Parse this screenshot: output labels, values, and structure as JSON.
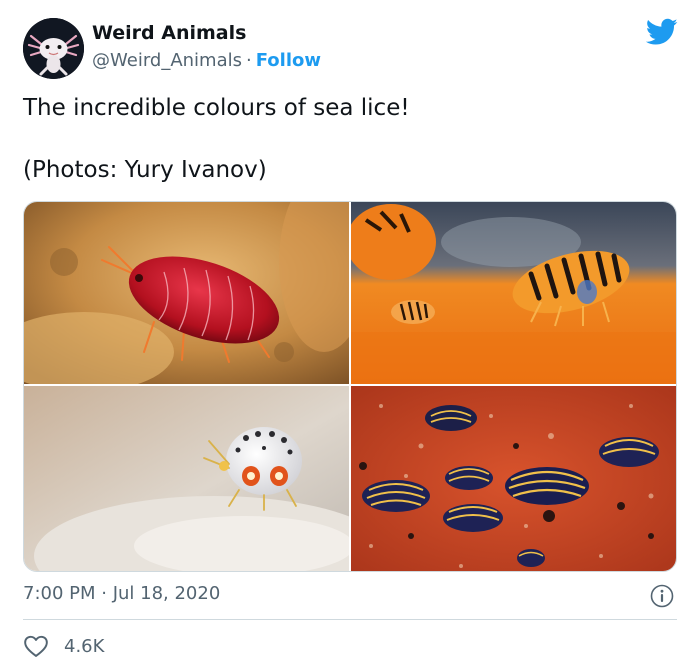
{
  "author": {
    "name": "Weird Animals",
    "handle": "@Weird_Animals",
    "separator": "·",
    "follow_label": "Follow",
    "avatar_icon": "axolotl-avatar",
    "platform_icon": "twitter-bird-icon"
  },
  "tweet": {
    "text_line1": "The incredible colours of sea lice!",
    "text_line2": "(Photos: Yury Ivanov)"
  },
  "photos": [
    {
      "subject": "red sea louse on sponge"
    },
    {
      "subject": "orange striped sea lice on orange surface"
    },
    {
      "subject": "white spotted sea louse"
    },
    {
      "subject": "blue and yellow striped sea lice on red surface"
    }
  ],
  "meta": {
    "timestamp": "7:00 PM · Jul 18, 2020",
    "info_icon": "info-icon"
  },
  "engagement": {
    "likes": "4.6K",
    "like_icon": "heart-icon"
  },
  "colors": {
    "accent": "#1d9bf0",
    "text": "#0f1419",
    "secondary": "#536471",
    "border": "#cfd9de"
  }
}
